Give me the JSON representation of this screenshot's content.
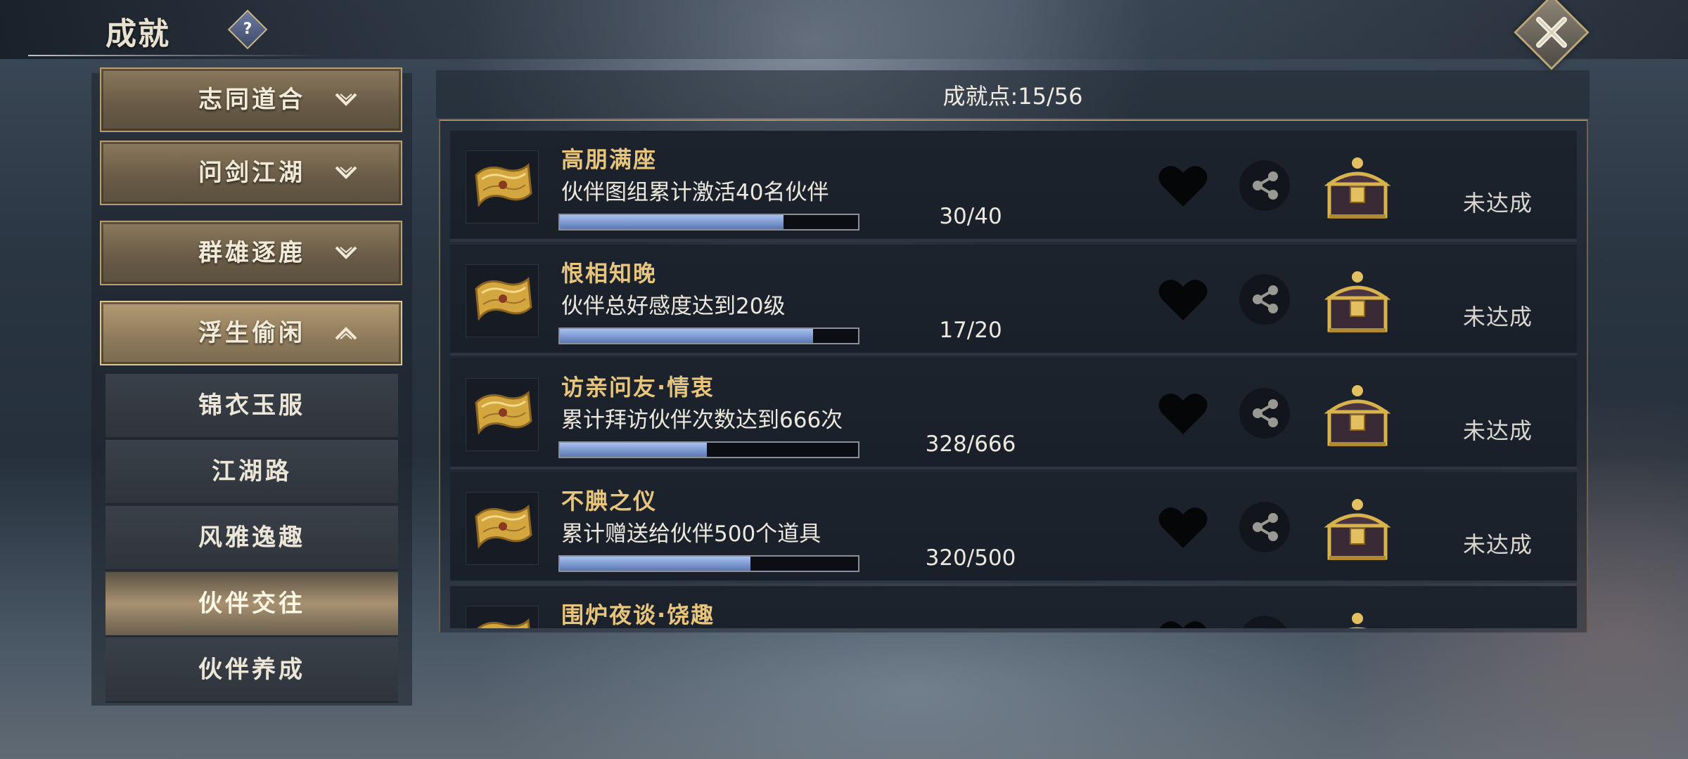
{
  "header": {
    "title": "成就",
    "help_glyph": "?",
    "help_icon": "question-mark-icon",
    "close_icon": "close-x-icon"
  },
  "menu": {
    "categories": [
      {
        "label": "志同道合",
        "expanded": false
      },
      {
        "label": "问剑江湖",
        "expanded": false
      },
      {
        "label": "群雄逐鹿",
        "expanded": false
      },
      {
        "label": "浮生偷闲",
        "expanded": true
      }
    ],
    "subitems": [
      {
        "label": "锦衣玉服",
        "selected": false
      },
      {
        "label": "江湖路",
        "selected": false
      },
      {
        "label": "风雅逸趣",
        "selected": false
      },
      {
        "label": "伙伴交往",
        "selected": true
      },
      {
        "label": "伙伴养成",
        "selected": false
      }
    ]
  },
  "summary": {
    "points_text": "成就点:15/56"
  },
  "achievements": [
    {
      "name": "高朋满座",
      "desc": "伙伴图组累计激活40名伙伴",
      "progress_text": "30/40",
      "fraction": 0.75,
      "status": "未达成"
    },
    {
      "name": "恨相知晚",
      "desc": "伙伴总好感度达到20级",
      "progress_text": "17/20",
      "fraction": 0.85,
      "status": "未达成"
    },
    {
      "name": "访亲问友·情衷",
      "desc": "累计拜访伙伴次数达到666次",
      "progress_text": "328/666",
      "fraction": 0.4925,
      "status": "未达成"
    },
    {
      "name": "不腆之仪",
      "desc": "累计赠送给伙伴500个道具",
      "progress_text": "320/500",
      "fraction": 0.64,
      "status": "未达成"
    },
    {
      "name": "围炉夜谈·饶趣",
      "desc": "",
      "progress_text": "",
      "fraction": 0,
      "status": ""
    }
  ],
  "icons": {
    "achievement": "scroll-icon",
    "like": "heart-icon",
    "share": "share-icon",
    "reward": "treasure-chest-icon"
  },
  "colors": {
    "accent_gold": "#e7c57c",
    "progress_blue": "#7f9bd2",
    "panel_dark": "#1d232d"
  }
}
